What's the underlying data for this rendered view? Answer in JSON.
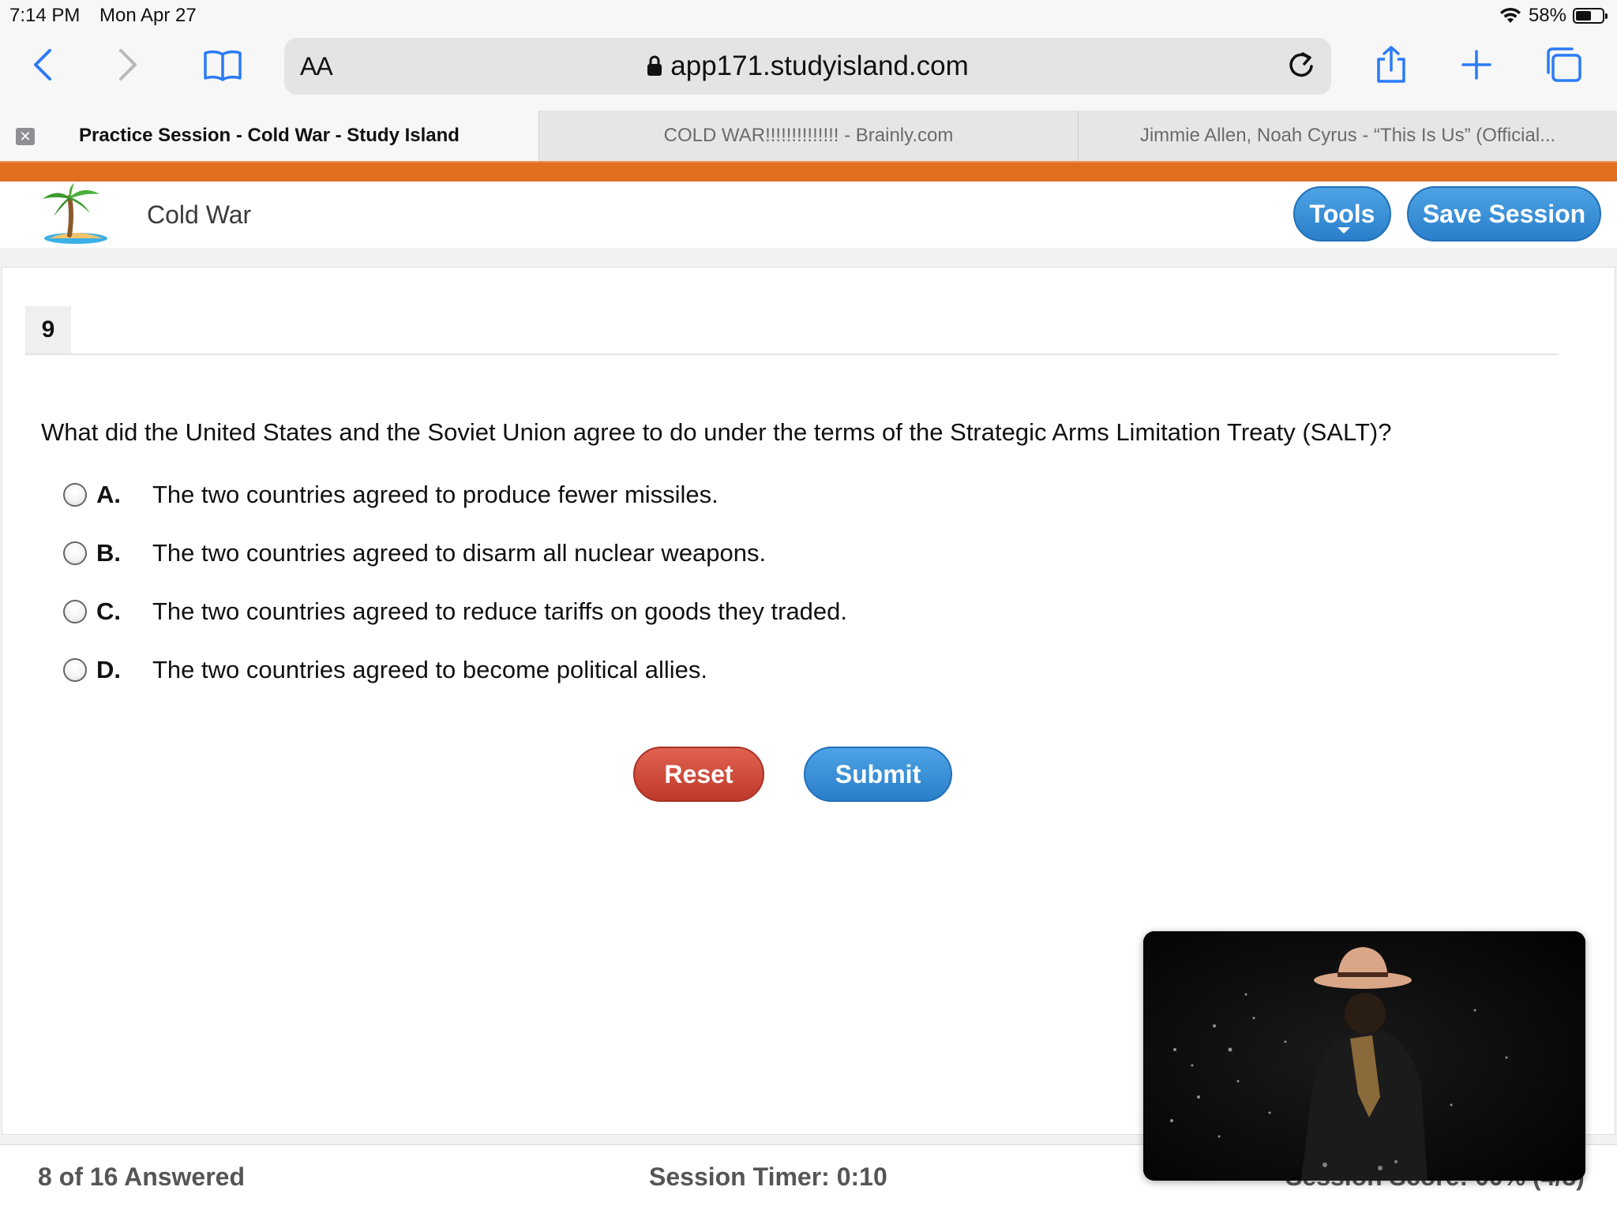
{
  "status_bar": {
    "time": "7:14 PM",
    "date": "Mon Apr 27",
    "battery": "58%",
    "battery_level": 0.58
  },
  "browser": {
    "text_size_label": "AA",
    "url": "app171.studyisland.com",
    "tabs": [
      {
        "title": "Practice Session - Cold War - Study Island"
      },
      {
        "title": "COLD WAR!!!!!!!!!!!!!! - Brainly.com"
      },
      {
        "title": "Jimmie Allen, Noah Cyrus - “This Is Us” (Official..."
      }
    ]
  },
  "header": {
    "title": "Cold War",
    "tools_label": "Tools",
    "save_label": "Save Session"
  },
  "question": {
    "number": "9",
    "text": "What did the United States and the Soviet Union agree to do under the terms of the Strategic Arms Limitation Treaty (SALT)?",
    "options": [
      {
        "letter": "A.",
        "text": "The two countries agreed to produce fewer missiles."
      },
      {
        "letter": "B.",
        "text": "The two countries agreed to disarm all nuclear weapons."
      },
      {
        "letter": "C.",
        "text": "The two countries agreed to reduce tariffs on goods they traded."
      },
      {
        "letter": "D.",
        "text": "The two countries agreed to become political allies."
      }
    ]
  },
  "buttons": {
    "reset": "Reset",
    "submit": "Submit"
  },
  "footer": {
    "answered": "8 of 16 Answered",
    "timer": "Session Timer: 0:10",
    "score": "Session Score: 00% (4/8)"
  },
  "colors": {
    "accent_orange": "#e0701f",
    "button_blue": "#2b7fcb",
    "button_red": "#c0392b"
  }
}
